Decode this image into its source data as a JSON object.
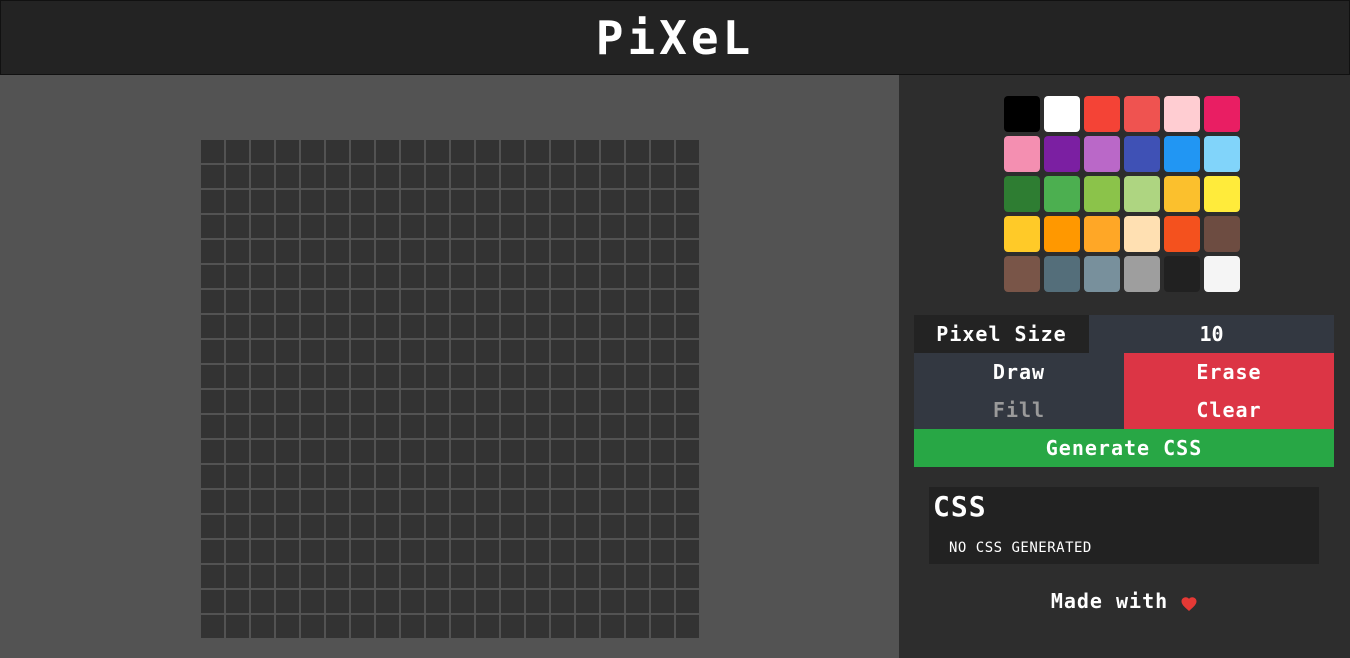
{
  "header": {
    "title": "PiXeL"
  },
  "canvas": {
    "columns": 20,
    "rows": 20,
    "cell_color": "#333333",
    "grid_line_color": "#535353"
  },
  "palette": {
    "colors": [
      "#000000",
      "#ffffff",
      "#f44336",
      "#ef5350",
      "#ffcdd2",
      "#e91e63",
      "#f48fb1",
      "#7b1fa2",
      "#ba68c8",
      "#3f51b5",
      "#2196f3",
      "#81d4fa",
      "#2e7d32",
      "#4caf50",
      "#8bc34a",
      "#aed581",
      "#fbc02d",
      "#ffeb3b",
      "#ffca28",
      "#ff9800",
      "#ffa726",
      "#ffe0b2",
      "#f4511e",
      "#6d4c41",
      "#795548",
      "#546e7a",
      "#78909c",
      "#9e9e9e",
      "#212121",
      "#f5f5f5"
    ]
  },
  "controls": {
    "pixel_size_label": "Pixel Size",
    "pixel_size_value": "10",
    "draw_label": "Draw",
    "erase_label": "Erase",
    "fill_label": "Fill",
    "clear_label": "Clear",
    "generate_label": "Generate CSS"
  },
  "css_panel": {
    "title": "CSS",
    "output": "NO CSS GENERATED"
  },
  "footer": {
    "text": "Made with",
    "icon": "heart-icon",
    "icon_color": "#e53935"
  },
  "theme": {
    "accent_red": "#dc3545",
    "accent_green": "#28a745",
    "button_dark": "#333841"
  }
}
